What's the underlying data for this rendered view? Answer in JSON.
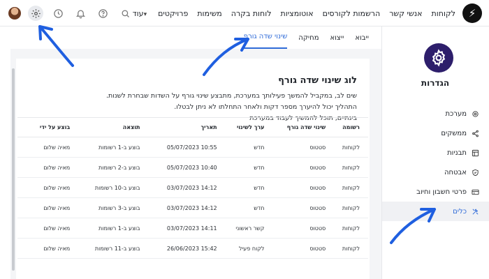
{
  "header": {
    "logo_glyph": "⚡",
    "nav": [
      "לקוחות",
      "אנשי קשר",
      "הרשמות לקורסים",
      "אוטומציות",
      "לוחות בקרה",
      "משימות",
      "פרויקטים",
      "עוד"
    ]
  },
  "sidebar": {
    "title": "הגדרות",
    "items": [
      {
        "label": "מערכת",
        "icon": "gear-icon"
      },
      {
        "label": "ממשקים",
        "icon": "share-icon"
      },
      {
        "label": "תבניות",
        "icon": "template-icon"
      },
      {
        "label": "אבטחה",
        "icon": "shield-icon"
      },
      {
        "label": "פרטי חשבון וחיוב",
        "icon": "card-icon"
      },
      {
        "label": "כלים",
        "icon": "tools-icon"
      }
    ],
    "active_index": 5
  },
  "tabs": [
    "ייבוא",
    "ייצוא",
    "מחיקה",
    "שינוי שדה גורף"
  ],
  "active_tab": 3,
  "log": {
    "title": "לוג שינוי שדה גורף",
    "lines": [
      "שים לב, במקביל להמשך פעילותך במערכת, מתבצע שינוי גורף על השדות שבחרת לשנות.",
      "התהליך יכול להיערך מספר דקות ולאחר התחלתו לא ניתן לבטלו.",
      "בינתיים, תוכל להמשיך לעבוד במערכת"
    ]
  },
  "table": {
    "columns": [
      "רשומה",
      "שינוי שדה גורף",
      "ערך לשינוי",
      "תאריך",
      "תוצאה",
      "בוצע על ידי"
    ],
    "rows": [
      [
        "לקוחות",
        "סטטוס",
        "חדש",
        "10:55 05/07/2023",
        "בוצע ב-1 רשומות",
        "מאיה שלום"
      ],
      [
        "לקוחות",
        "סטטוס",
        "חדש",
        "10:40 05/07/2023",
        "בוצע ב-2 רשומות",
        "מאיה שלום"
      ],
      [
        "לקוחות",
        "סטטוס",
        "חדש",
        "14:12 03/07/2023",
        "בוצע ב-10 רשומות",
        "מאיה שלום"
      ],
      [
        "לקוחות",
        "סטטוס",
        "חדש",
        "14:12 03/07/2023",
        "בוצע ב-3 רשומות",
        "מאיה שלום"
      ],
      [
        "לקוחות",
        "סטטוס",
        "קשר ראשוני",
        "14:11 03/07/2023",
        "בוצע ב-1 רשומות",
        "מאיה שלום"
      ],
      [
        "לקוחות",
        "סטטוס",
        "לקוח פעיל",
        "15:42 26/06/2023",
        "בוצע ב-11 רשומות",
        "מאיה שלום"
      ]
    ]
  },
  "colors": {
    "accent": "#2f6bd8",
    "brand_dark": "#2d1e6b",
    "annotation": "#1f5fe0"
  }
}
